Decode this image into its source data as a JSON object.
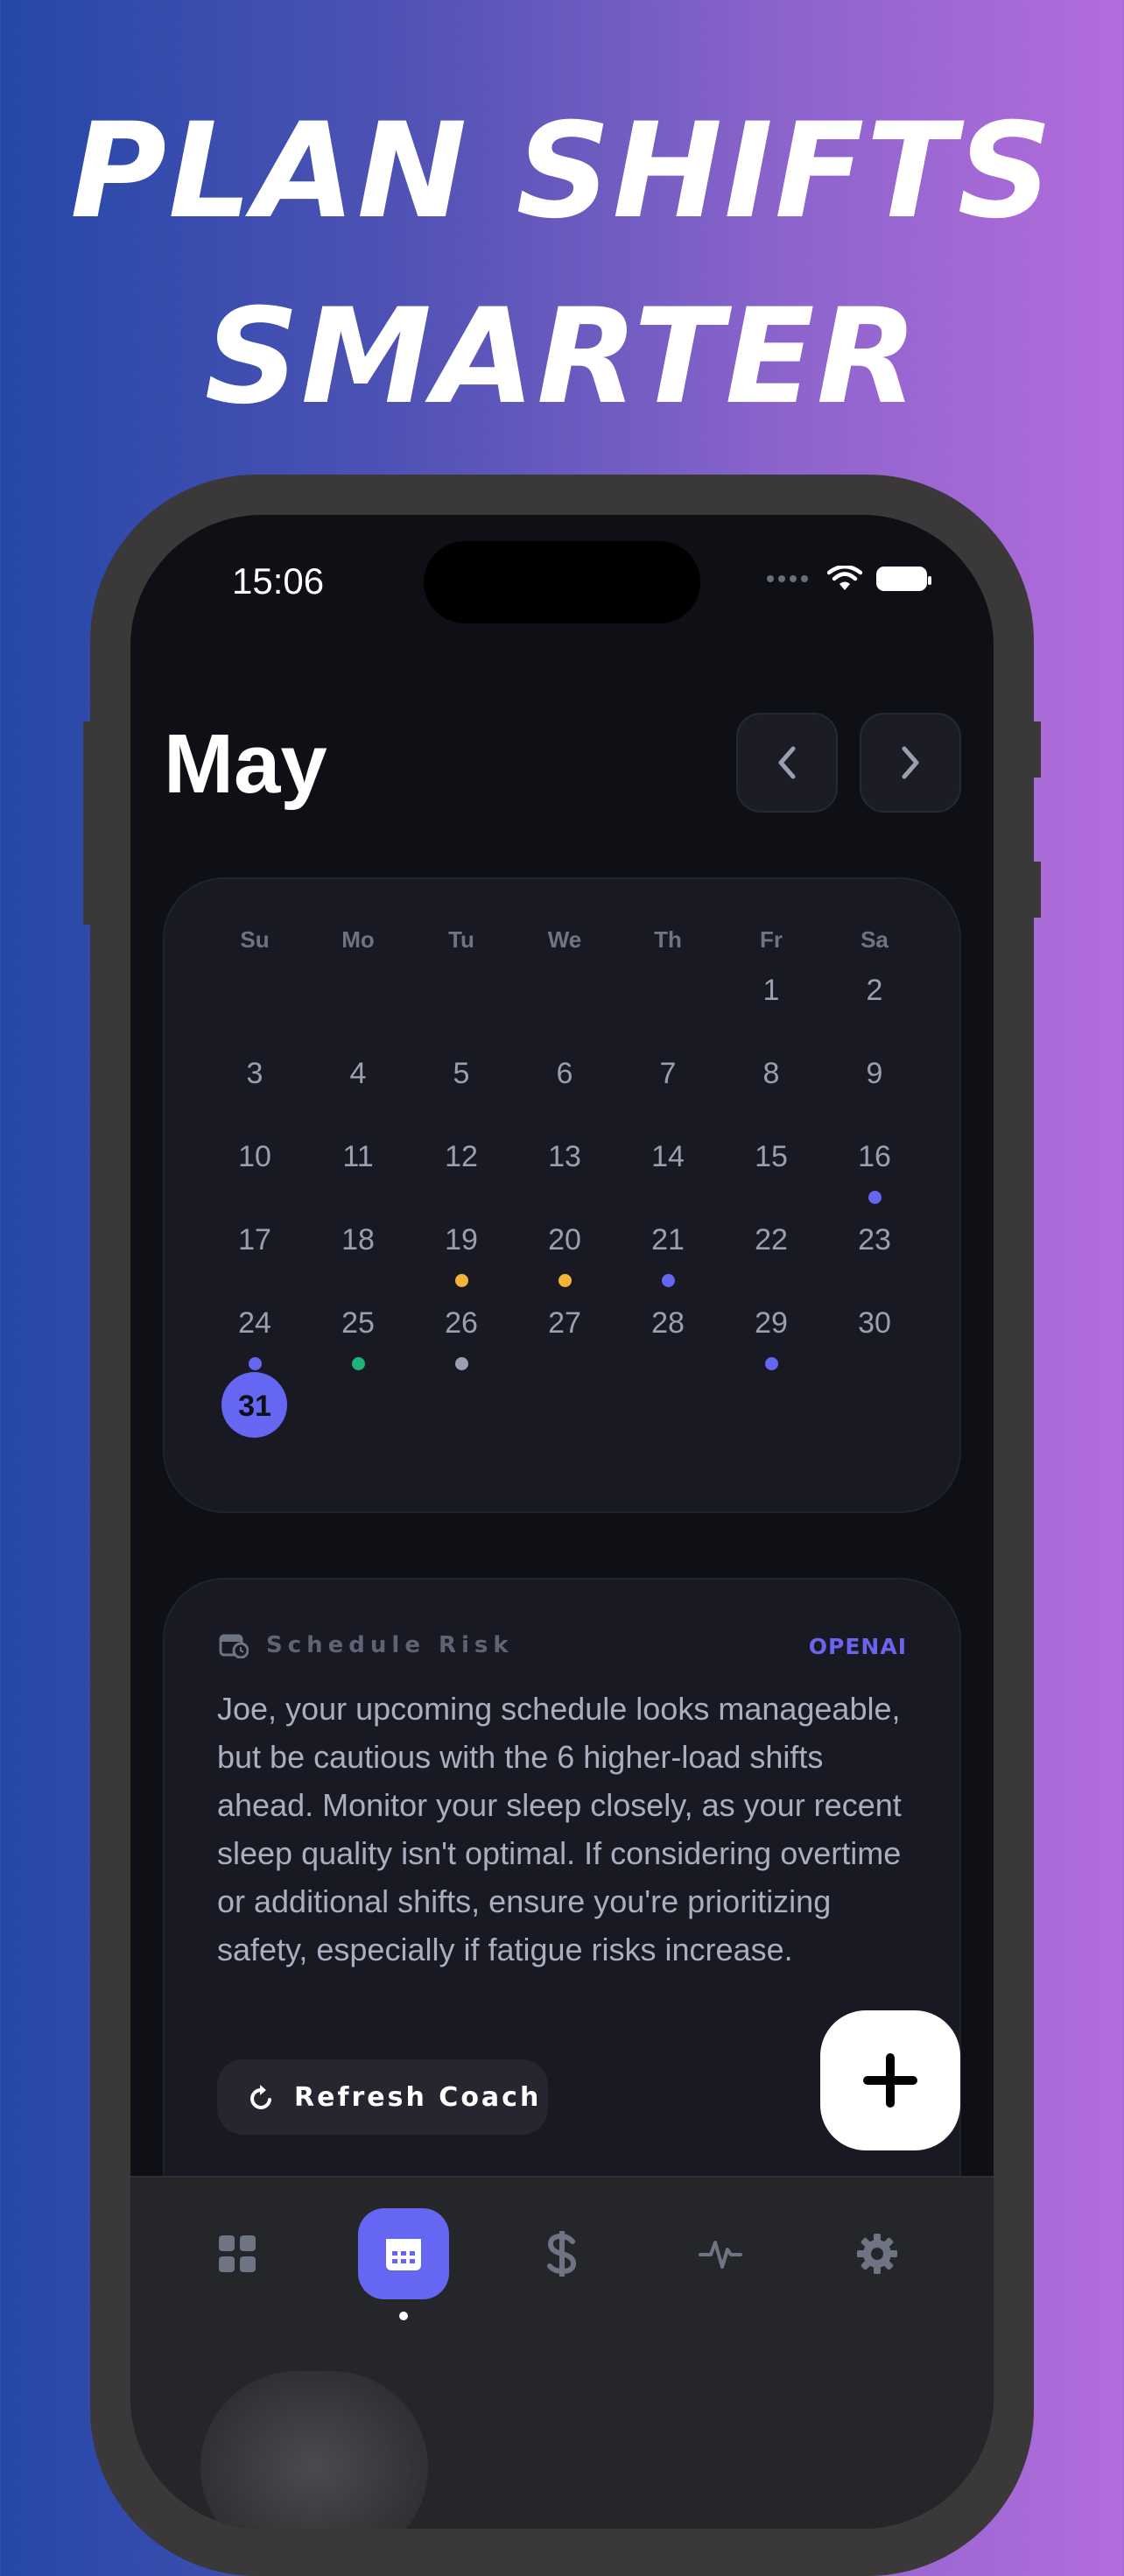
{
  "headline": {
    "line1": "PLAN SHIFTS",
    "line2": "SMARTER"
  },
  "status_bar": {
    "time": "15:06"
  },
  "calendar": {
    "month": "May",
    "weekdays": [
      "Su",
      "Mo",
      "Tu",
      "We",
      "Th",
      "Fr",
      "Sa"
    ],
    "weeks": [
      [
        "",
        "",
        "",
        "",
        "",
        "1",
        "2"
      ],
      [
        "3",
        "4",
        "5",
        "6",
        "7",
        "8",
        "9"
      ],
      [
        "10",
        "11",
        "12",
        "13",
        "14",
        "15",
        "16"
      ],
      [
        "17",
        "18",
        "19",
        "20",
        "21",
        "22",
        "23"
      ],
      [
        "24",
        "25",
        "26",
        "27",
        "28",
        "29",
        "30"
      ],
      [
        "31",
        "",
        "",
        "",
        "",
        "",
        ""
      ]
    ],
    "today": "31",
    "markers": {
      "16": "#6566f2",
      "19": "#f3b43a",
      "20": "#f3b43a",
      "21": "#6566f2",
      "24": "#6566f2",
      "25": "#1fb27a",
      "26": "#9aa0b2",
      "29": "#6566f2"
    }
  },
  "risk_card": {
    "title": "Schedule Risk",
    "badge": "OPENAI",
    "message": "Joe, your upcoming schedule looks manageable, but be cautious with the 6 higher-load shifts ahead. Monitor your sleep closely, as your recent sleep quality isn't optimal. If considering overtime or additional shifts, ensure you're prioritizing safety, especially if fatigue risks increase.",
    "refresh_label": "Refresh Coach"
  },
  "tabs": [
    {
      "icon": "grid-icon",
      "active": false
    },
    {
      "icon": "calendar-icon",
      "active": true
    },
    {
      "icon": "dollar-icon",
      "active": false
    },
    {
      "icon": "activity-icon",
      "active": false
    },
    {
      "icon": "gear-icon",
      "active": false
    }
  ],
  "colors": {
    "accent": "#6566f2",
    "warn": "#f3b43a",
    "ok": "#1fb27a"
  }
}
